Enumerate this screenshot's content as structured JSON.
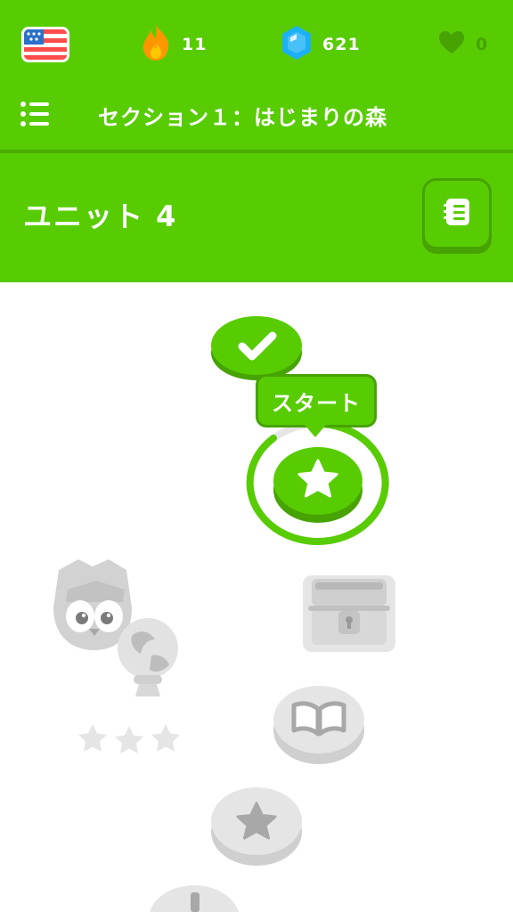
{
  "header": {
    "language_flag": "us-flag-icon",
    "streak": {
      "icon": "fire-icon",
      "value": "11"
    },
    "gems": {
      "icon": "gem-icon",
      "value": "621"
    },
    "hearts": {
      "icon": "heart-icon",
      "value": "0"
    },
    "section_title": "セクション１：はじまりの森",
    "menu_icon": "list-icon"
  },
  "unit": {
    "title": "ユニット 4",
    "guidebook_icon": "guidebook-icon"
  },
  "path": {
    "start_label": "スタート",
    "nodes": [
      {
        "name": "completed-lesson",
        "icon": "check-icon",
        "state": "completed"
      },
      {
        "name": "current-lesson",
        "icon": "star-icon",
        "state": "active",
        "progress": 0.9
      },
      {
        "name": "treasure-chest",
        "icon": "chest-icon",
        "state": "locked"
      },
      {
        "name": "story-lesson",
        "icon": "book-icon",
        "state": "locked"
      },
      {
        "name": "lesson",
        "icon": "star-icon",
        "state": "locked"
      },
      {
        "name": "practice-lesson",
        "icon": "dumbbell-icon",
        "state": "locked"
      }
    ],
    "character": {
      "icon": "owl-crystal-ball-icon",
      "stars": 3
    }
  },
  "colors": {
    "primary": "#58cc02",
    "primary_dark": "#46a302",
    "locked": "#e5e5e5",
    "locked_dark": "#cfcfcf",
    "flame": "#ff9600",
    "gem": "#1cb0f6"
  }
}
